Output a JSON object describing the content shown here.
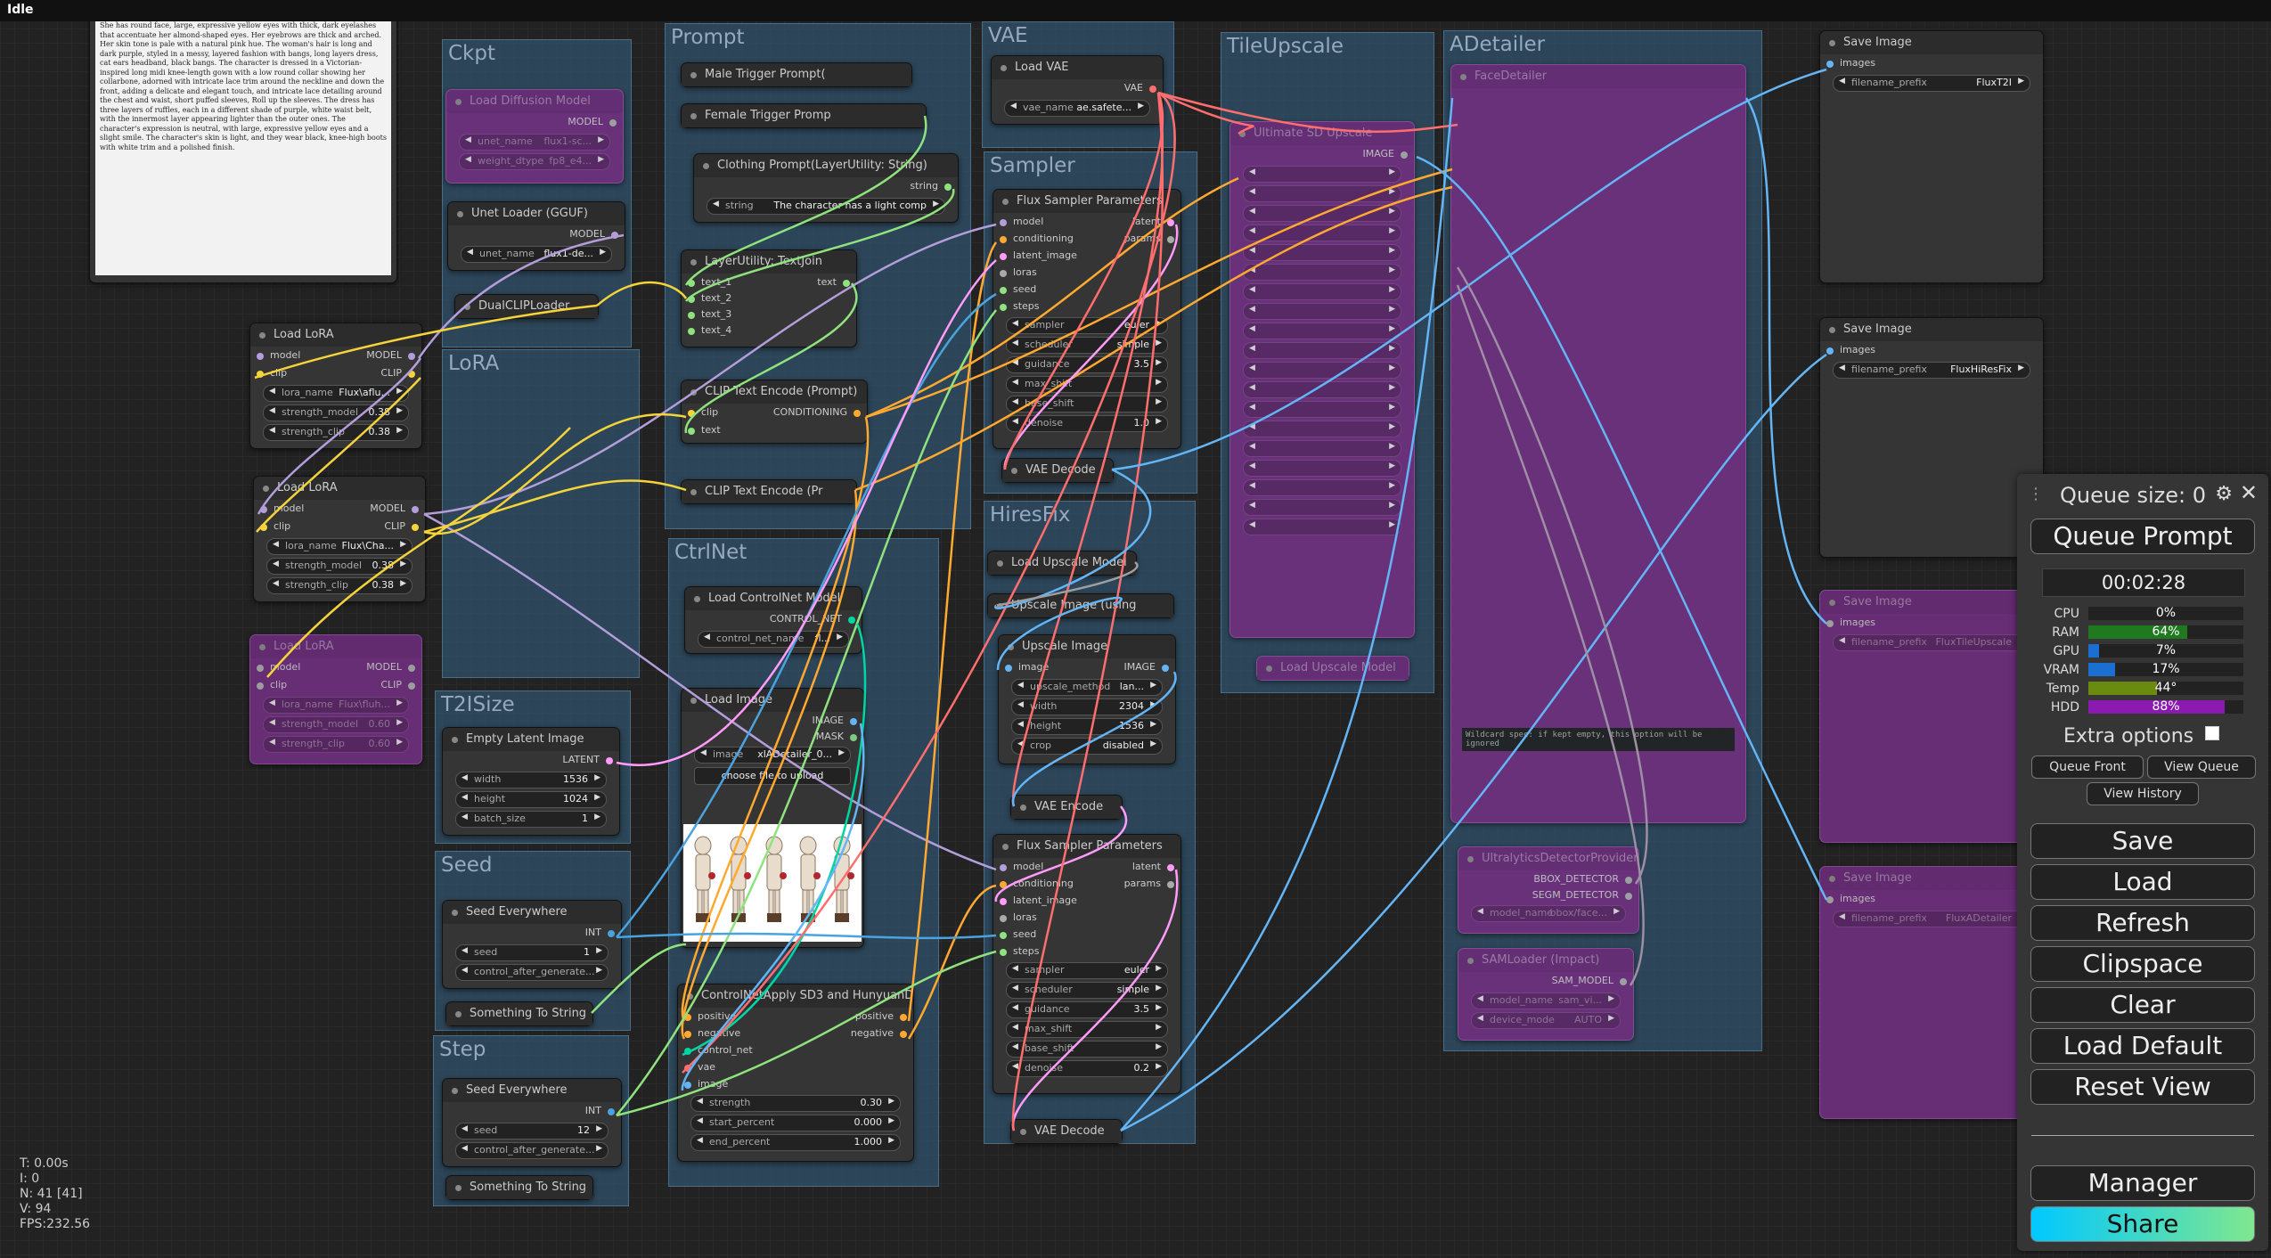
{
  "status": "Idle",
  "prompt_text": "She has round face, large, expressive yellow eyes with thick, dark eyelashes that accentuate her almond-shaped eyes. Her eyebrows are thick and arched. Her skin tone is pale with a natural pink hue. The woman's hair is long and dark purple, styled in a messy, layered fashion with bangs, long layers dress, cat ears headband, black bangs. The character is dressed in a Victorian-inspired long midi knee-length gown with a low round collar showing her collarbone, adorned with intricate lace trim around the neckline and down the front, adding a delicate and elegant touch, and intricate lace detailing around the chest and waist, short puffed sleeves, Roll up the sleeves. The dress has three layers of ruffles, each in a different shade of purple, white waist belt, with the innermost layer appearing lighter than the outer ones. The character's expression is neutral, with large, expressive yellow eyes and a slight smile. The character's skin is light, and they wear black, knee-high boots with white trim and a polished finish.",
  "groups": {
    "ckpt": "Ckpt",
    "lora": "LoRA",
    "t2isize": "T2ISize",
    "seed": "Seed",
    "step": "Step",
    "prompt": "Prompt",
    "ctrlnet": "CtrlNet",
    "vae": "VAE",
    "sampler": "Sampler",
    "hiresfix": "HiresFix",
    "tileupscale": "TileUpscale",
    "adetailer": "ADetailer"
  },
  "nodes": {
    "load_diffusion": {
      "title": "Load Diffusion Model",
      "out": "MODEL",
      "w1l": "unet_name",
      "w1v": "flux1-sc...",
      "w2l": "weight_dtype",
      "w2v": "fp8_e4..."
    },
    "unet_loader": {
      "title": "Unet Loader (GGUF)",
      "out": "MODEL",
      "w1l": "unet_name",
      "w1v": "flux1-de..."
    },
    "dualclip": {
      "title": "DualCLIPLoader"
    },
    "lora1": {
      "title": "Load LoRA",
      "in1": "model",
      "in2": "clip",
      "out1": "MODEL",
      "out2": "CLIP",
      "name_l": "lora_name",
      "name_v": "Flux\\aflu...",
      "sm_l": "strength_model",
      "sm_v": "0.38",
      "sc_l": "strength_clip",
      "sc_v": "0.38"
    },
    "lora2": {
      "title": "Load LoRA",
      "in1": "model",
      "in2": "clip",
      "out1": "MODEL",
      "out2": "CLIP",
      "name_l": "lora_name",
      "name_v": "Flux\\Cha...",
      "sm_l": "strength_model",
      "sm_v": "0.38",
      "sc_l": "strength_clip",
      "sc_v": "0.38"
    },
    "lora3": {
      "title": "Load LoRA",
      "in1": "model",
      "in2": "clip",
      "out1": "MODEL",
      "out2": "CLIP",
      "name_l": "lora_name",
      "name_v": "Flux\\fluh...",
      "sm_l": "strength_model",
      "sm_v": "0.60",
      "sc_l": "strength_clip",
      "sc_v": "0.60"
    },
    "empty_latent": {
      "title": "Empty Latent Image",
      "out": "LATENT",
      "w_l": "width",
      "w_v": "1536",
      "h_l": "height",
      "h_v": "1024",
      "b_l": "batch_size",
      "b_v": "1"
    },
    "seed1": {
      "title": "Seed Everywhere",
      "out": "INT",
      "s_l": "seed",
      "s_v": "1",
      "c_l": "control_after_generate..."
    },
    "tostring1": {
      "title": "Something To String"
    },
    "seed2": {
      "title": "Seed Everywhere",
      "out": "INT",
      "s_l": "seed",
      "s_v": "12",
      "c_l": "control_after_generate..."
    },
    "tostring2": {
      "title": "Something To String"
    },
    "male_trigger": {
      "title": "Male Trigger Prompt("
    },
    "female_trigger": {
      "title": "Female Trigger Promp"
    },
    "clothing": {
      "title": "Clothing Prompt(LayerUtility: String)",
      "out": "string",
      "w_l": "string",
      "w_v": "The character has a light comp"
    },
    "textjoin": {
      "title": "LayerUtility: TextJoin",
      "in1": "text_1",
      "in2": "text_2",
      "in3": "text_3",
      "in4": "text_4",
      "out": "text"
    },
    "clip_encode": {
      "title": "CLIP Text Encode (Prompt)",
      "in1": "clip",
      "in2": "text",
      "out": "CONDITIONING"
    },
    "clip_encode2": {
      "title": "CLIP Text Encode (Pr"
    },
    "load_controlnet": {
      "title": "Load ControlNet Model",
      "out": "CONTROL_NET",
      "w_l": "control_net_name",
      "w_v": "fl..."
    },
    "load_image": {
      "title": "Load Image",
      "out1": "IMAGE",
      "out2": "MASK",
      "w_l": "image",
      "w_v": "xlADetailer_0...",
      "btn": "choose file to upload"
    },
    "controlnet_apply": {
      "title": "ControlNetApply SD3 and HunyuanDiT",
      "in1": "positive",
      "in2": "negative",
      "in3": "control_net",
      "in4": "vae",
      "in5": "image",
      "out1": "positive",
      "out2": "negative",
      "s_l": "strength",
      "s_v": "0.30",
      "sp_l": "start_percent",
      "sp_v": "0.000",
      "ep_l": "end_percent",
      "ep_v": "1.000"
    },
    "load_vae": {
      "title": "Load VAE",
      "out": "VAE",
      "w_l": "vae_name",
      "w_v": "ae.safete..."
    },
    "flux_sampler1": {
      "title": "Flux Sampler Parameters",
      "in1": "model",
      "in2": "conditioning",
      "in3": "latent_image",
      "in4": "loras",
      "in5": "seed",
      "in6": "steps",
      "out1": "latent",
      "out2": "params",
      "sampler_l": "sampler",
      "sampler_v": "euler",
      "scheduler_l": "scheduler",
      "scheduler_v": "simple",
      "guidance_l": "guidance",
      "guidance_v": "3.5",
      "maxshift_l": "max_shift",
      "baseshift_l": "base_shift",
      "denoise_l": "denoise",
      "denoise_v": "1.0"
    },
    "vae_decode1": {
      "title": "VAE Decode"
    },
    "load_upscale": {
      "title": "Load Upscale Model"
    },
    "upscale_using": {
      "title": "Upscale Image (using"
    },
    "upscale_image": {
      "title": "Upscale Image",
      "in1": "image",
      "out": "IMAGE",
      "m_l": "upscale_method",
      "m_v": "lan...",
      "w_l": "width",
      "w_v": "2304",
      "h_l": "height",
      "h_v": "1536",
      "c_l": "crop",
      "c_v": "disabled"
    },
    "vae_encode": {
      "title": "VAE Encode"
    },
    "flux_sampler2": {
      "title": "Flux Sampler Parameters",
      "in1": "model",
      "in2": "conditioning",
      "in3": "latent_image",
      "in4": "loras",
      "in5": "seed",
      "in6": "steps",
      "out1": "latent",
      "out2": "params",
      "sampler_l": "sampler",
      "sampler_v": "euler",
      "scheduler_l": "scheduler",
      "scheduler_v": "simple",
      "guidance_l": "guidance",
      "guidance_v": "3.5",
      "maxshift_l": "max_shift",
      "baseshift_l": "base_shift",
      "denoise_l": "denoise",
      "denoise_v": "0.2"
    },
    "vae_decode2": {
      "title": "VAE Decode"
    },
    "ultimate_sd": {
      "title": "Ultimate SD Upscale",
      "out": "IMAGE"
    },
    "load_upscale2": {
      "title": "Load Upscale Model"
    },
    "face_detailer": {
      "title": "FaceDetailer",
      "wildcard": "Wildcard spec: if kept empty, this option will be ignored"
    },
    "ultralytics": {
      "title": "UltralyticsDetectorProvider",
      "out1": "BBOX_DETECTOR",
      "out2": "SEGM_DETECTOR",
      "w_l": "model_name",
      "w_v": "bbox/face..."
    },
    "samloader": {
      "title": "SAMLoader (Impact)",
      "out": "SAM_MODEL",
      "w1_l": "model_name",
      "w1_v": "sam_vi...",
      "w2_l": "device_mode",
      "w2_v": "AUTO"
    },
    "save1": {
      "title": "Save Image",
      "in": "images",
      "w_l": "filename_prefix",
      "w_v": "FluxT2I"
    },
    "save2": {
      "title": "Save Image",
      "in": "images",
      "w_l": "filename_prefix",
      "w_v": "FluxHiResFix"
    },
    "save3": {
      "title": "Save Image",
      "in": "images",
      "w_l": "filename_prefix",
      "w_v": "FluxTileUpscale"
    },
    "save4": {
      "title": "Save Image",
      "in": "images",
      "w_l": "filename_prefix",
      "w_v": "FluxADetailer"
    }
  },
  "stats": {
    "t": "T: 0.00s",
    "i": "I: 0",
    "n": "N: 41 [41]",
    "v": "V: 94",
    "fps": "FPS:232.56"
  },
  "menu": {
    "queue_size": "Queue size: 0",
    "queue_prompt": "Queue Prompt",
    "timer": "00:02:28",
    "monitors": [
      {
        "label": "CPU",
        "value": "0%",
        "fill": 0.0,
        "color": "#2a8a2a"
      },
      {
        "label": "RAM",
        "value": "64%",
        "fill": 0.64,
        "color": "#1f7a1f"
      },
      {
        "label": "GPU",
        "value": "7%",
        "fill": 0.07,
        "color": "#1a6fd1"
      },
      {
        "label": "VRAM",
        "value": "17%",
        "fill": 0.17,
        "color": "#1a6fd1"
      },
      {
        "label": "Temp",
        "value": "44°",
        "fill": 0.44,
        "color": "#6a8a10"
      },
      {
        "label": "HDD",
        "value": "88%",
        "fill": 0.88,
        "color": "#8a1ab0"
      }
    ],
    "extra_options": "Extra options",
    "queue_front": "Queue Front",
    "view_queue": "View Queue",
    "view_history": "View History",
    "save": "Save",
    "load": "Load",
    "refresh": "Refresh",
    "clipspace": "Clipspace",
    "clear": "Clear",
    "load_default": "Load Default",
    "reset_view": "Reset View",
    "manager": "Manager",
    "share": "Share"
  }
}
